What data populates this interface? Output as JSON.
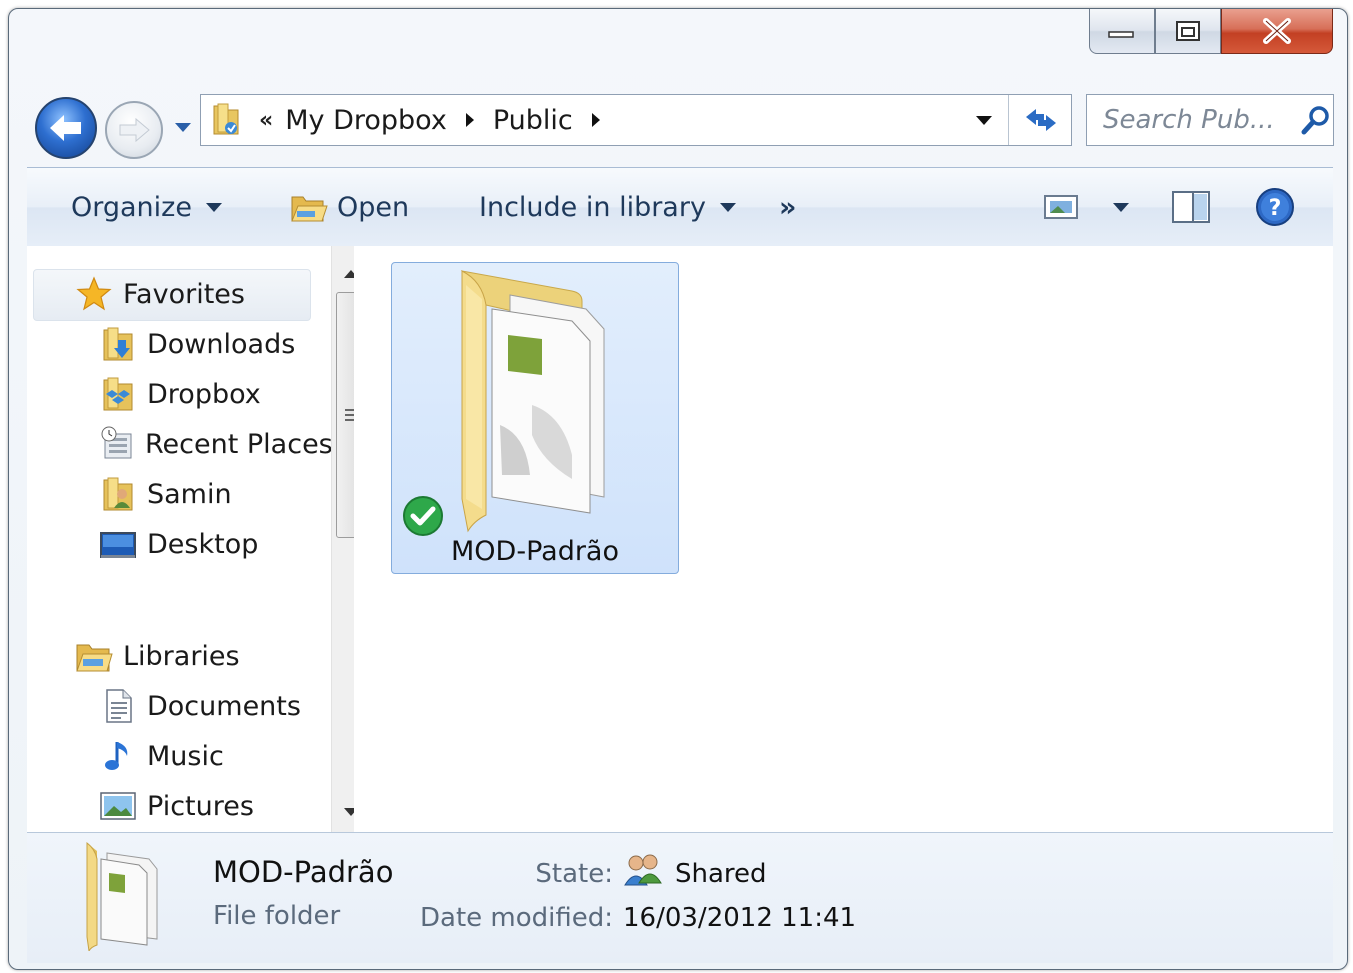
{
  "window": {
    "caption_buttons": [
      "minimize-button",
      "maximize-button",
      "close-button"
    ]
  },
  "address_bar": {
    "overflow_chevron": "«",
    "breadcrumbs": [
      "My Dropbox",
      "Public"
    ]
  },
  "search": {
    "placeholder": "Search Pub..."
  },
  "toolbar": {
    "organize": "Organize",
    "open": "Open",
    "include_in_library": "Include in library",
    "more": "»"
  },
  "nav": {
    "favorites_header": "Favorites",
    "favorites": [
      "Downloads",
      "Dropbox",
      "Recent Places",
      "Samin",
      "Desktop"
    ],
    "libraries_header": "Libraries",
    "libraries": [
      "Documents",
      "Music",
      "Pictures"
    ]
  },
  "content": {
    "items": [
      {
        "name": "MOD-Padrão",
        "sync_status": "synced"
      }
    ]
  },
  "details": {
    "name": "MOD-Padrão",
    "type": "File folder",
    "state_label": "State:",
    "state_value": "Shared",
    "date_label": "Date modified:",
    "date_value": "16/03/2012 11:41"
  },
  "colors": {
    "selection_bg": "#cfe2fb",
    "selection_border": "#84acdd",
    "toolbar_text": "#1e395b",
    "close_button": "#c34023"
  }
}
